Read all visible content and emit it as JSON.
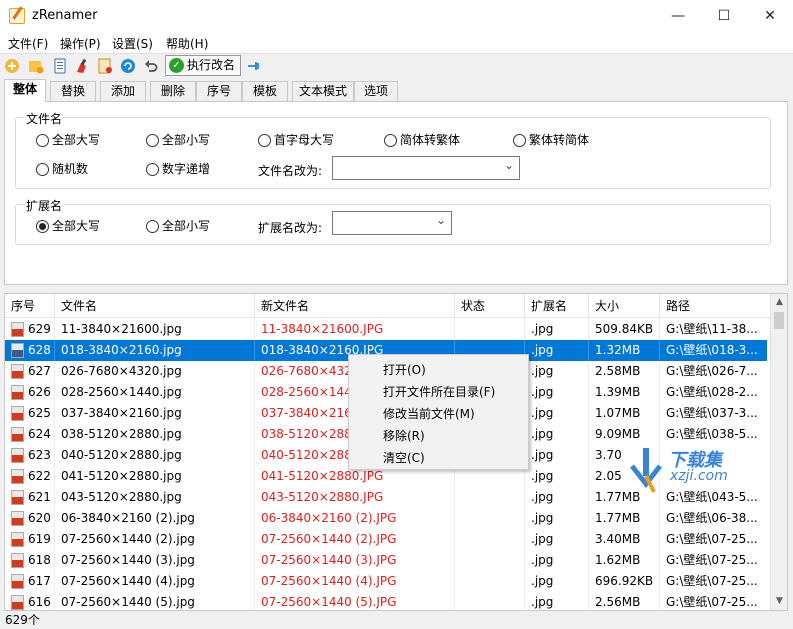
{
  "window": {
    "title": "zRenamer",
    "minimize": "—",
    "maximize": "☐",
    "close": "✕"
  },
  "menu": [
    "文件(F)",
    "操作(P)",
    "设置(S)",
    "帮助(H)"
  ],
  "toolbar": {
    "execute_label": "执行改名",
    "check": "✓"
  },
  "tabs": [
    "整体",
    "替换",
    "添加",
    "删除",
    "序号",
    "模板",
    "文本模式",
    "选项"
  ],
  "filename_group": {
    "title": "文件名",
    "options": [
      "全部大写",
      "全部小写",
      "首字母大写",
      "简体转繁体",
      "繁体转简体",
      "随机数",
      "数字递增"
    ],
    "rename_label": "文件名改为:"
  },
  "ext_group": {
    "title": "扩展名",
    "options": [
      "全部大写",
      "全部小写"
    ],
    "rename_label": "扩展名改为:"
  },
  "table": {
    "headers": [
      "序号",
      "文件名",
      "新文件名",
      "状态",
      "扩展名",
      "大小",
      "路径"
    ],
    "rows": [
      {
        "no": "629",
        "name": "11-3840×21600.jpg",
        "newname": "11-3840×21600.JPG",
        "ext": ".jpg",
        "size": "509.84KB",
        "path": "G:\\壁纸\\11-38..."
      },
      {
        "no": "628",
        "name": "018-3840×2160.jpg",
        "newname": "018-3840×2160.JPG",
        "ext": ".jpg",
        "size": "1.32MB",
        "path": "G:\\壁纸\\018-3..."
      },
      {
        "no": "627",
        "name": "026-7680×4320.jpg",
        "newname": "026-7680×4320",
        "ext": ".jpg",
        "size": "2.58MB",
        "path": "G:\\壁纸\\026-7..."
      },
      {
        "no": "626",
        "name": "028-2560×1440.jpg",
        "newname": "028-2560×1440",
        "ext": ".jpg",
        "size": "1.39MB",
        "path": "G:\\壁纸\\028-2..."
      },
      {
        "no": "625",
        "name": "037-3840×2160.jpg",
        "newname": "037-3840×2160",
        "ext": ".jpg",
        "size": "1.07MB",
        "path": "G:\\壁纸\\037-3..."
      },
      {
        "no": "624",
        "name": "038-5120×2880.jpg",
        "newname": "038-5120×2880",
        "ext": ".jpg",
        "size": "9.09MB",
        "path": "G:\\壁纸\\038-5..."
      },
      {
        "no": "623",
        "name": "040-5120×2880.jpg",
        "newname": "040-5120×2880",
        "ext": ".jpg",
        "size": "3.70",
        "path": ""
      },
      {
        "no": "622",
        "name": "041-5120×2880.jpg",
        "newname": "041-5120×2880.JPG",
        "ext": ".jpg",
        "size": "2.05",
        "path": ""
      },
      {
        "no": "621",
        "name": "043-5120×2880.jpg",
        "newname": "043-5120×2880.JPG",
        "ext": ".jpg",
        "size": "1.77MB",
        "path": "G:\\壁纸\\043-5..."
      },
      {
        "no": "620",
        "name": "06-3840×2160 (2).jpg",
        "newname": "06-3840×2160 (2).JPG",
        "ext": ".jpg",
        "size": "1.77MB",
        "path": "G:\\壁纸\\06-38..."
      },
      {
        "no": "619",
        "name": "07-2560×1440 (2).jpg",
        "newname": "07-2560×1440 (2).JPG",
        "ext": ".jpg",
        "size": "3.40MB",
        "path": "G:\\壁纸\\07-25..."
      },
      {
        "no": "618",
        "name": "07-2560×1440 (3).jpg",
        "newname": "07-2560×1440 (3).JPG",
        "ext": ".jpg",
        "size": "1.62MB",
        "path": "G:\\壁纸\\07-25..."
      },
      {
        "no": "617",
        "name": "07-2560×1440 (4).jpg",
        "newname": "07-2560×1440 (4).JPG",
        "ext": ".jpg",
        "size": "696.92KB",
        "path": "G:\\壁纸\\07-25..."
      },
      {
        "no": "616",
        "name": "07-2560×1440 (5).jpg",
        "newname": "07-2560×1440 (5).JPG",
        "ext": ".jpg",
        "size": "2.56MB",
        "path": "G:\\壁纸\\07-25..."
      }
    ]
  },
  "context_menu": [
    "打开(O)",
    "打开文件所在目录(F)",
    "修改当前文件(M)",
    "移除(R)",
    "清空(C)"
  ],
  "watermark": {
    "text": "下载集",
    "sub": "xzji.com"
  },
  "status": "629个",
  "colors": {
    "selection": "#0078d7",
    "newname": "#e31b1b"
  }
}
